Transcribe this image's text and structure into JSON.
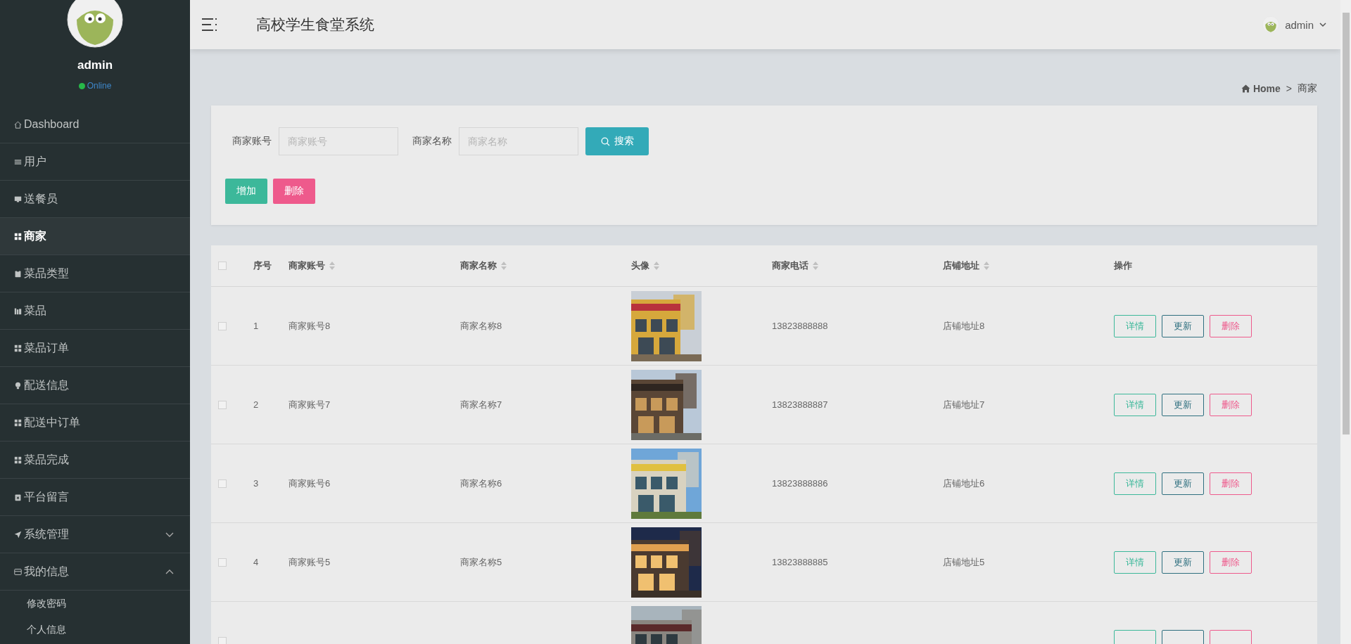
{
  "sidebar": {
    "user": {
      "name": "admin",
      "status": "Online"
    },
    "items": [
      {
        "label": "Dashboard",
        "kind": "link",
        "selected": false
      },
      {
        "label": "用户",
        "kind": "link",
        "selected": false
      },
      {
        "label": "送餐员",
        "kind": "link",
        "selected": false
      },
      {
        "label": "商家",
        "kind": "link",
        "selected": true
      },
      {
        "label": "菜品类型",
        "kind": "link",
        "selected": false
      },
      {
        "label": "菜品",
        "kind": "link",
        "selected": false
      },
      {
        "label": "菜品订单",
        "kind": "link",
        "selected": false
      },
      {
        "label": "配送信息",
        "kind": "link",
        "selected": false
      },
      {
        "label": "配送中订单",
        "kind": "link",
        "selected": false
      },
      {
        "label": "菜品完成",
        "kind": "link",
        "selected": false
      },
      {
        "label": "平台留言",
        "kind": "link",
        "selected": false
      },
      {
        "label": "系统管理",
        "kind": "group",
        "expanded": false
      },
      {
        "label": "我的信息",
        "kind": "group",
        "expanded": true,
        "children": [
          {
            "label": "修改密码"
          },
          {
            "label": "个人信息"
          }
        ]
      }
    ]
  },
  "header": {
    "title": "高校学生食堂系统",
    "user": "admin"
  },
  "breadcrumb": {
    "links": [
      "Home",
      "商家"
    ],
    "separator": ">"
  },
  "search": {
    "fields": [
      {
        "label": "商家账号",
        "placeholder": "商家账号"
      },
      {
        "label": "商家名称",
        "placeholder": "商家名称"
      }
    ],
    "button": "搜索"
  },
  "actions": [
    {
      "label": "增加",
      "kind": "add"
    },
    {
      "label": "删除",
      "kind": "delete"
    }
  ],
  "table": {
    "all_checked": false,
    "columns": [
      {
        "label": "序号",
        "sortable": false
      },
      {
        "label": "商家账号",
        "sortable": true
      },
      {
        "label": "商家名称",
        "sortable": true
      },
      {
        "label": "头像",
        "sortable": true
      },
      {
        "label": "商家电话",
        "sortable": true
      },
      {
        "label": "店铺地址",
        "sortable": true
      },
      {
        "label": "操作",
        "sortable": false
      }
    ],
    "rows": [
      {
        "checked": false,
        "index": "1",
        "account": "商家账号8",
        "name": "商家名称8",
        "phone": "13823888888",
        "address": "店铺地址8",
        "actions": [
          {
            "label": "详情",
            "kind": "detail"
          },
          {
            "label": "更新",
            "kind": "update"
          },
          {
            "label": "删除",
            "kind": "delete"
          }
        ]
      },
      {
        "checked": false,
        "index": "2",
        "account": "商家账号7",
        "name": "商家名称7",
        "phone": "13823888887",
        "address": "店铺地址7",
        "actions": [
          {
            "label": "详情",
            "kind": "detail"
          },
          {
            "label": "更新",
            "kind": "update"
          },
          {
            "label": "删除",
            "kind": "delete"
          }
        ]
      },
      {
        "checked": false,
        "index": "3",
        "account": "商家账号6",
        "name": "商家名称6",
        "phone": "13823888886",
        "address": "店铺地址6",
        "actions": [
          {
            "label": "详情",
            "kind": "detail"
          },
          {
            "label": "更新",
            "kind": "update"
          },
          {
            "label": "删除",
            "kind": "delete"
          }
        ]
      },
      {
        "checked": false,
        "index": "4",
        "account": "商家账号5",
        "name": "商家名称5",
        "phone": "13823888885",
        "address": "店铺地址5",
        "actions": [
          {
            "label": "详情",
            "kind": "detail"
          },
          {
            "label": "更新",
            "kind": "update"
          },
          {
            "label": "删除",
            "kind": "delete"
          }
        ]
      },
      {
        "checked": false,
        "actions": [
          {
            "kind": "detail"
          },
          {
            "kind": "update"
          },
          {
            "kind": "delete"
          }
        ]
      }
    ]
  }
}
